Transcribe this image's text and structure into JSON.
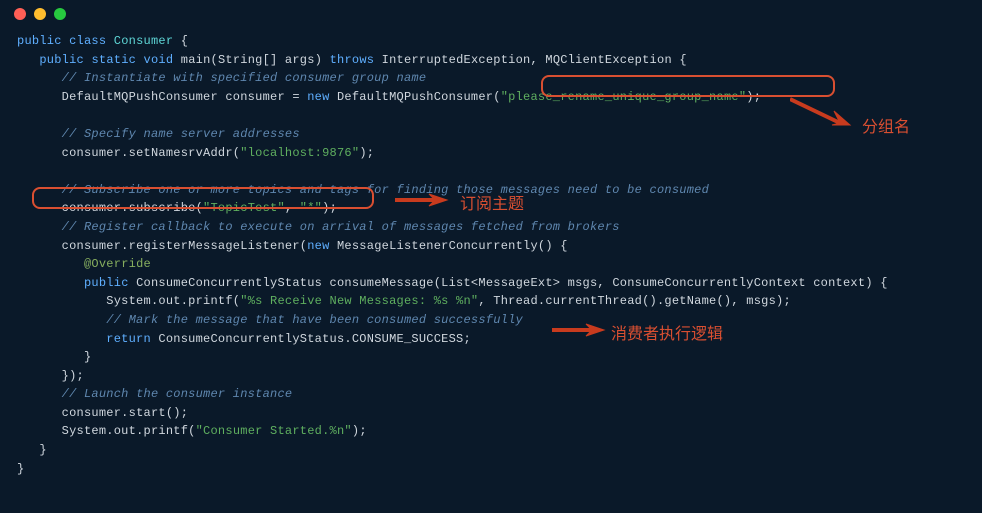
{
  "traffic": {
    "red": "#ff5f56",
    "yellow": "#ffbd2e",
    "green": "#27c93f"
  },
  "labels": {
    "group_name": "分组名",
    "subscribe_topic": "订阅主题",
    "consume_logic": "消费者执行逻辑"
  },
  "code": {
    "l01_kw_public": "public",
    "l01_kw_class": "class",
    "l01_classname": "Consumer",
    "l01_brace": " {",
    "l02_indent": "   ",
    "l02_kw_public": "public",
    "l02_kw_static": "static",
    "l02_kw_void": "void",
    "l02_main": " main(String[] args) ",
    "l02_kw_throws": "throws",
    "l02_ex": " InterruptedException, MQClientException {",
    "l03_indent": "      ",
    "l03_comment": "// Instantiate with specified consumer group name",
    "l04_indent": "      ",
    "l04_a": "DefaultMQPushConsumer consumer = ",
    "l04_new": "new",
    "l04_b": " DefaultMQPushConsumer(",
    "l04_str": "\"please_rename_unique_group_name\"",
    "l04_c": ");",
    "l05": "",
    "l06_indent": "      ",
    "l06_comment": "// Specify name server addresses",
    "l07_indent": "      ",
    "l07_a": "consumer.setNamesrvAddr(",
    "l07_str": "\"localhost:9876\"",
    "l07_b": ");",
    "l08": "",
    "l09_indent": "      ",
    "l09_comment": "// Subscribe one or more topics and tags for finding those messages need to be consumed",
    "l10_indent": "      ",
    "l10_a": "consumer.subscribe(",
    "l10_str1": "\"TopicTest\"",
    "l10_b": ", ",
    "l10_str2": "\"*\"",
    "l10_c": ");",
    "l11_indent": "      ",
    "l11_comment": "// Register callback to execute on arrival of messages fetched from brokers",
    "l12_indent": "      ",
    "l12_a": "consumer.registerMessageListener(",
    "l12_new": "new",
    "l12_b": " MessageListenerConcurrently() {",
    "l13_indent": "         ",
    "l13_anno": "@Override",
    "l14_indent": "         ",
    "l14_kw_public": "public",
    "l14_a": " ConsumeConcurrentlyStatus consumeMessage(List<MessageExt> msgs, ConsumeConcurrentlyContext context) {",
    "l15_indent": "            ",
    "l15_a": "System.out.printf(",
    "l15_str": "\"%s Receive New Messages: %s %n\"",
    "l15_b": ", Thread.currentThread().getName(), msgs);",
    "l16_indent": "            ",
    "l16_comment": "// Mark the message that have been consumed successfully",
    "l17_indent": "            ",
    "l17_kw_return": "return",
    "l17_a": " ConsumeConcurrentlyStatus.CONSUME_SUCCESS;",
    "l18_indent": "         ",
    "l18_a": "}",
    "l19_indent": "      ",
    "l19_a": "});",
    "l20_indent": "      ",
    "l20_comment": "// Launch the consumer instance",
    "l21_indent": "      ",
    "l21_a": "consumer.start();",
    "l22_indent": "      ",
    "l22_a": "System.out.printf(",
    "l22_str": "\"Consumer Started.%n\"",
    "l22_b": ");",
    "l23_indent": "   ",
    "l23_a": "}",
    "l24_a": "}"
  }
}
